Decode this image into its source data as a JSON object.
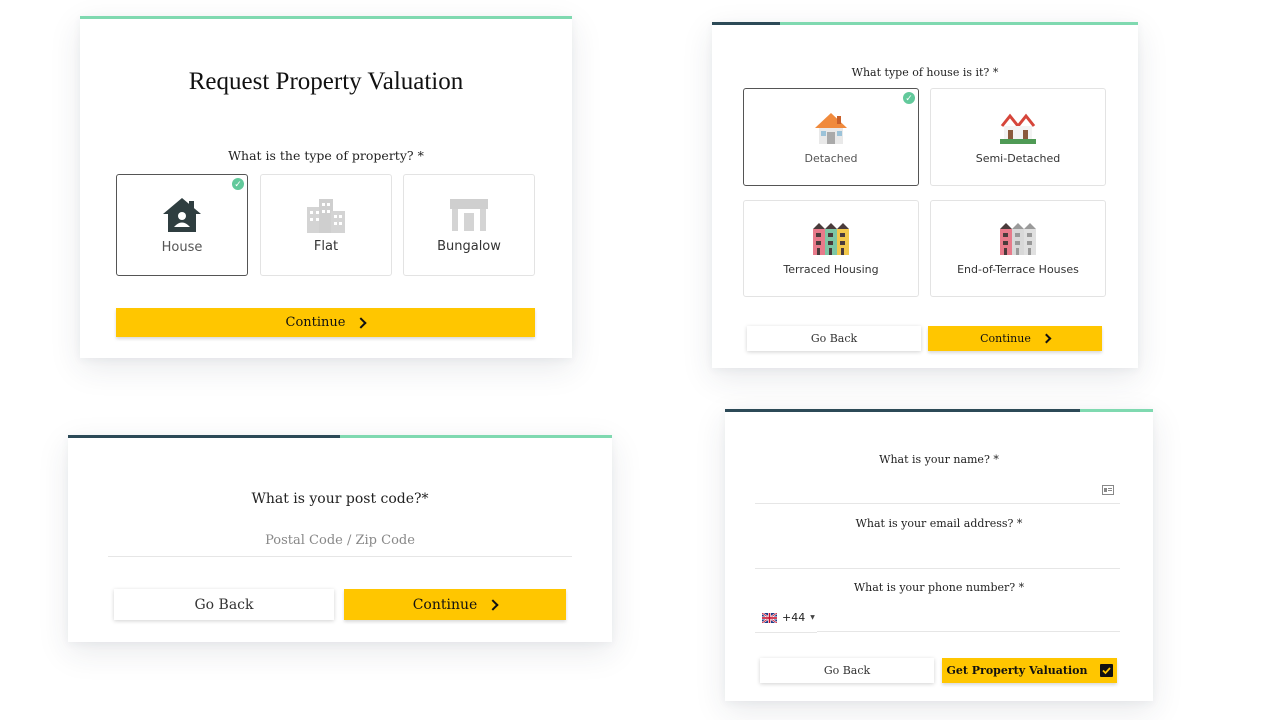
{
  "card1": {
    "title": "Request Property Valuation",
    "question": "What is the type of property? *",
    "options": [
      {
        "label": "House",
        "icon": "house-icon",
        "selected": true
      },
      {
        "label": "Flat",
        "icon": "flat-building-icon",
        "selected": false
      },
      {
        "label": "Bungalow",
        "icon": "bungalow-icon",
        "selected": false
      }
    ],
    "continue_label": "Continue"
  },
  "card2": {
    "question": "What type of house is it? *",
    "options": [
      {
        "label": "Detached",
        "icon": "detached-house-icon",
        "selected": true
      },
      {
        "label": "Semi-Detached",
        "icon": "semi-detached-house-icon",
        "selected": false
      },
      {
        "label": "Terraced Housing",
        "icon": "terraced-housing-icon",
        "selected": false
      },
      {
        "label": "End-of-Terrace Houses",
        "icon": "end-of-terrace-icon",
        "selected": false
      }
    ],
    "back_label": "Go Back",
    "continue_label": "Continue"
  },
  "card3": {
    "question": "What is your post code?*",
    "postcode_placeholder": "Postal Code / Zip Code",
    "back_label": "Go Back",
    "continue_label": "Continue"
  },
  "card4": {
    "name_question": "What is your name? *",
    "email_question": "What is your email address? *",
    "phone_question": "What is your phone number? *",
    "phone_prefix": "+44",
    "phone_flag": "uk-flag-icon",
    "back_label": "Go Back",
    "submit_label": "Get Property Valuation"
  },
  "colors": {
    "accent_yellow": "#ffc600",
    "progress_done": "#2c4a57",
    "progress_track": "#7fd9b0",
    "check_green": "#62c99b"
  }
}
